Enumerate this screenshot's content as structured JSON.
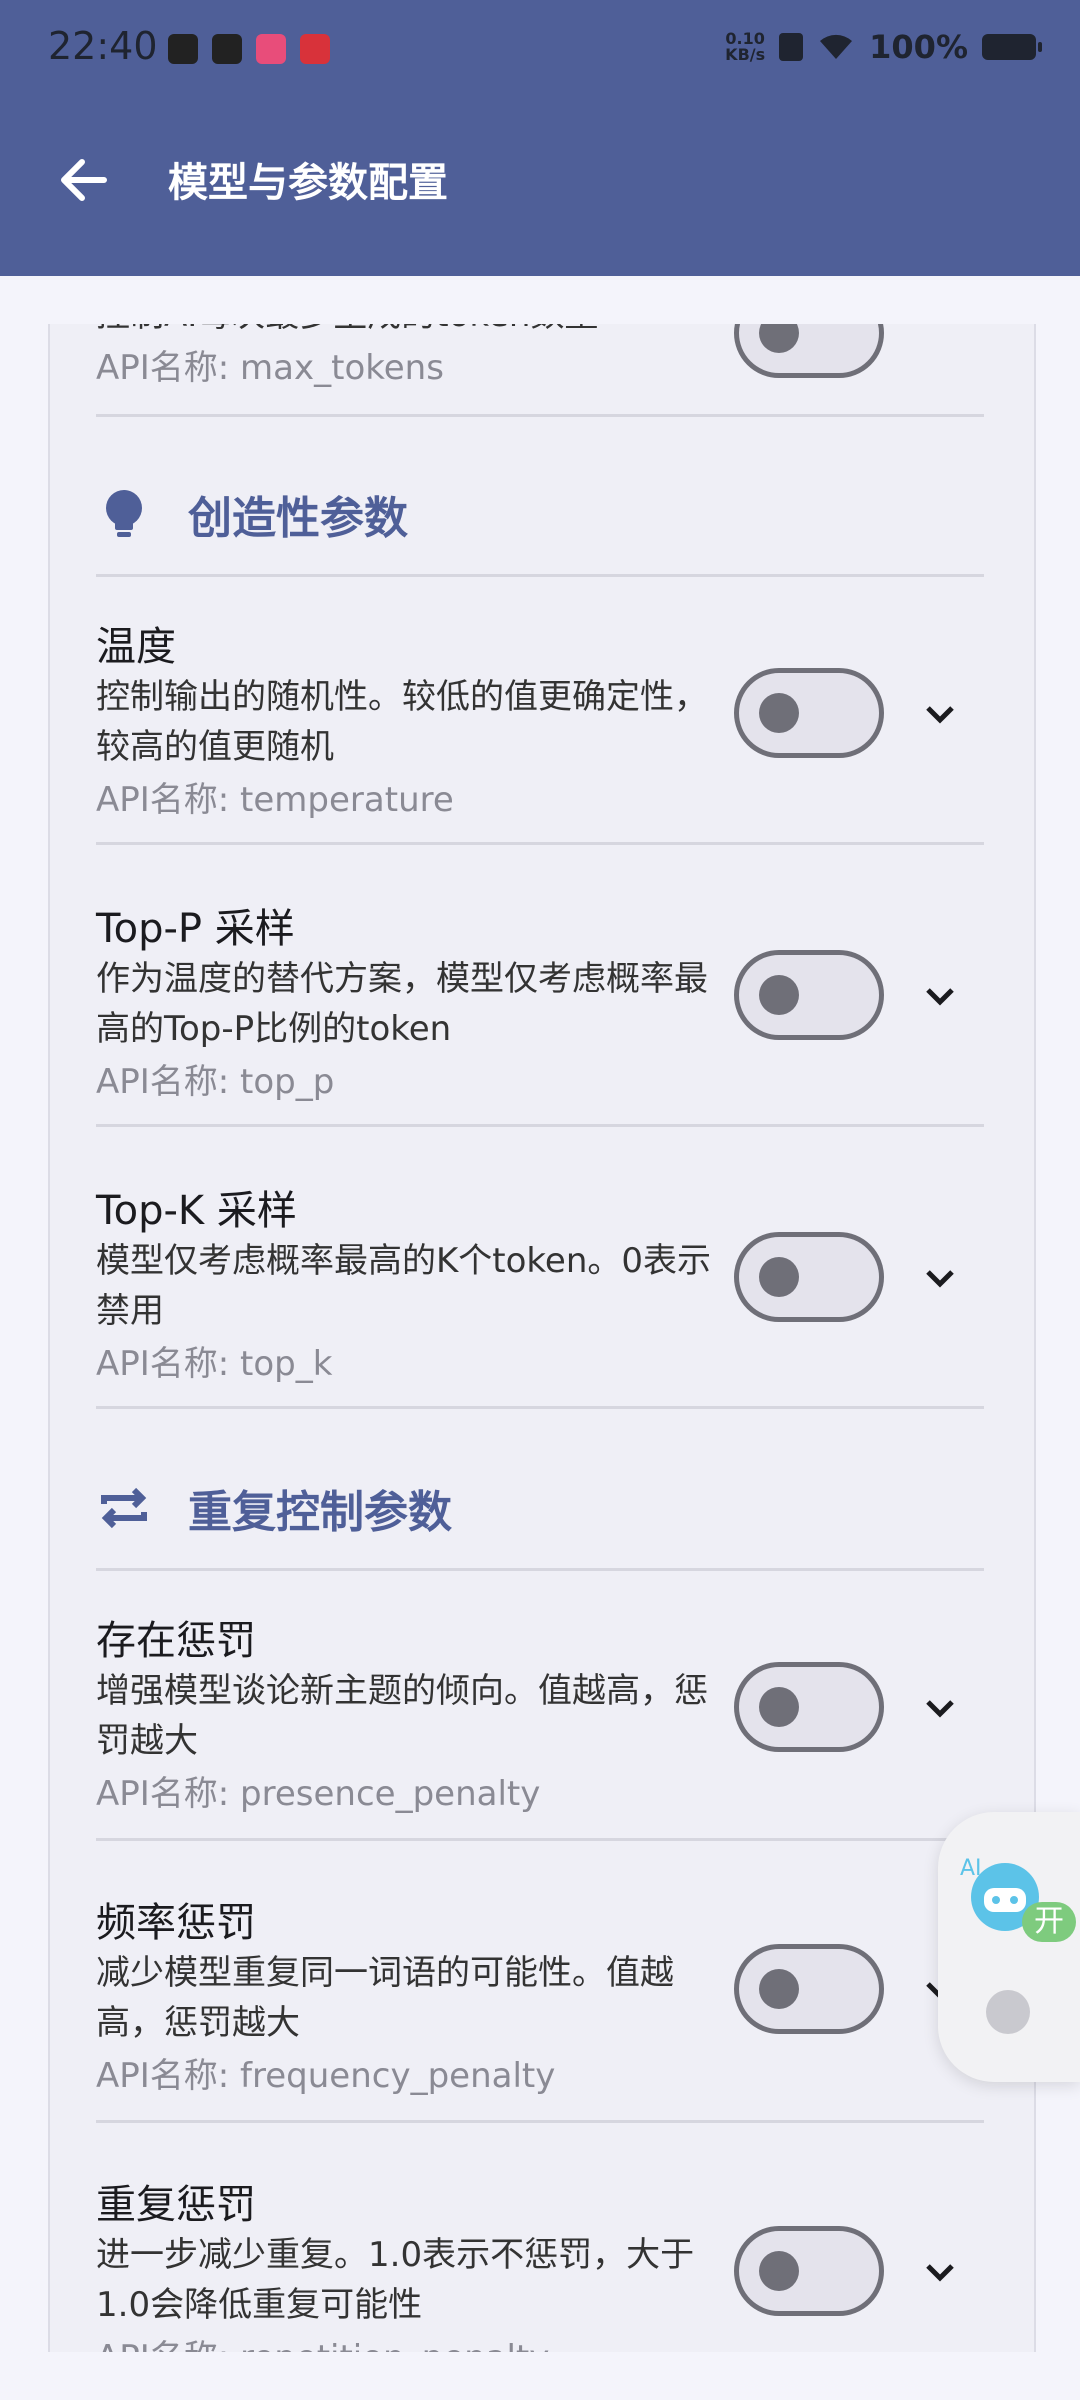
{
  "status_bar": {
    "time": "22:40",
    "speed_top": "0.10",
    "speed_bottom": "KB/s",
    "battery": "100%"
  },
  "header": {
    "title": "模型与参数配置"
  },
  "partial_item": {
    "desc": "控制AI每次最多生成的token数量",
    "api": "API名称: max_tokens"
  },
  "sections": {
    "creativity": {
      "title": "创造性参数",
      "icon": "lightbulb-icon"
    },
    "repetition": {
      "title": "重复控制参数",
      "icon": "repeat-icon"
    }
  },
  "items": [
    {
      "name": "温度",
      "desc": "控制输出的随机性。较低的值更确定性，较高的值更随机",
      "api": "API名称: temperature",
      "enabled": false
    },
    {
      "name": "Top-P 采样",
      "desc": "作为温度的替代方案，模型仅考虑概率最高的Top-P比例的token",
      "api": "API名称: top_p",
      "enabled": false
    },
    {
      "name": "Top-K 采样",
      "desc": "模型仅考虑概率最高的K个token。0表示禁用",
      "api": "API名称: top_k",
      "enabled": false
    },
    {
      "name": "存在惩罚",
      "desc": "增强模型谈论新主题的倾向。值越高，惩罚越大",
      "api": "API名称: presence_penalty",
      "enabled": false
    },
    {
      "name": "频率惩罚",
      "desc": "减少模型重复同一词语的可能性。值越高，惩罚越大",
      "api": "API名称: frequency_penalty",
      "enabled": false
    },
    {
      "name": "重复惩罚",
      "desc": "进一步减少重复。1.0表示不惩罚，大于1.0会降低重复可能性",
      "api": "API名称: repetition_penalty",
      "enabled": false
    }
  ],
  "floating": {
    "badge": "开",
    "label": "AI"
  },
  "colors": {
    "appbar": "#4f5f98",
    "accent": "#4f5f98",
    "background": "#f4f4fb"
  }
}
